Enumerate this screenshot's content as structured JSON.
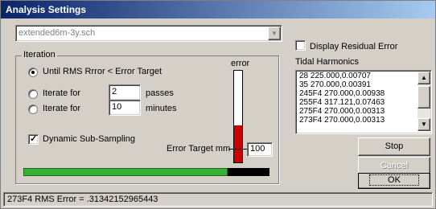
{
  "window": {
    "title": "Analysis Settings"
  },
  "file_combo": {
    "value": "extended6m-3y.sch"
  },
  "display_residual": {
    "label": "Display Residual Error",
    "checked": false
  },
  "iteration": {
    "group_label": "Iteration",
    "option_until": "Until RMS Rrror < Error Target",
    "option_iterate_passes": "Iterate for",
    "passes_value": "2",
    "passes_unit": "passes",
    "option_iterate_minutes": "Iterate for",
    "minutes_value": "10",
    "minutes_unit": "minutes",
    "selected": "until",
    "dynamic_subsampling": {
      "label": "Dynamic Sub-Sampling",
      "checked": true
    },
    "error_label": "error",
    "error_fill_fraction": 0.4,
    "error_target_label": "Error Target mm",
    "error_target_value": "100"
  },
  "tidal": {
    "label": "Tidal Harmonics",
    "items": [
      "28 225.000,0.00707",
      "35 270.000,0.00391",
      "245F4 270.000,0.00938",
      "255F4 317.121,0.07463",
      "275F4 270.000,0.00313",
      "273F4 270.000,0.00313"
    ]
  },
  "buttons": {
    "stop": "Stop",
    "cancel": "Cancel",
    "ok": "OK"
  },
  "progress": {
    "fraction": 0.83
  },
  "status": {
    "text": "273F4 RMS Error = .31342152965443"
  },
  "colors": {
    "error_fill": "#cc0000",
    "progress_fill": "#38b038",
    "title_start": "#0a246a"
  }
}
